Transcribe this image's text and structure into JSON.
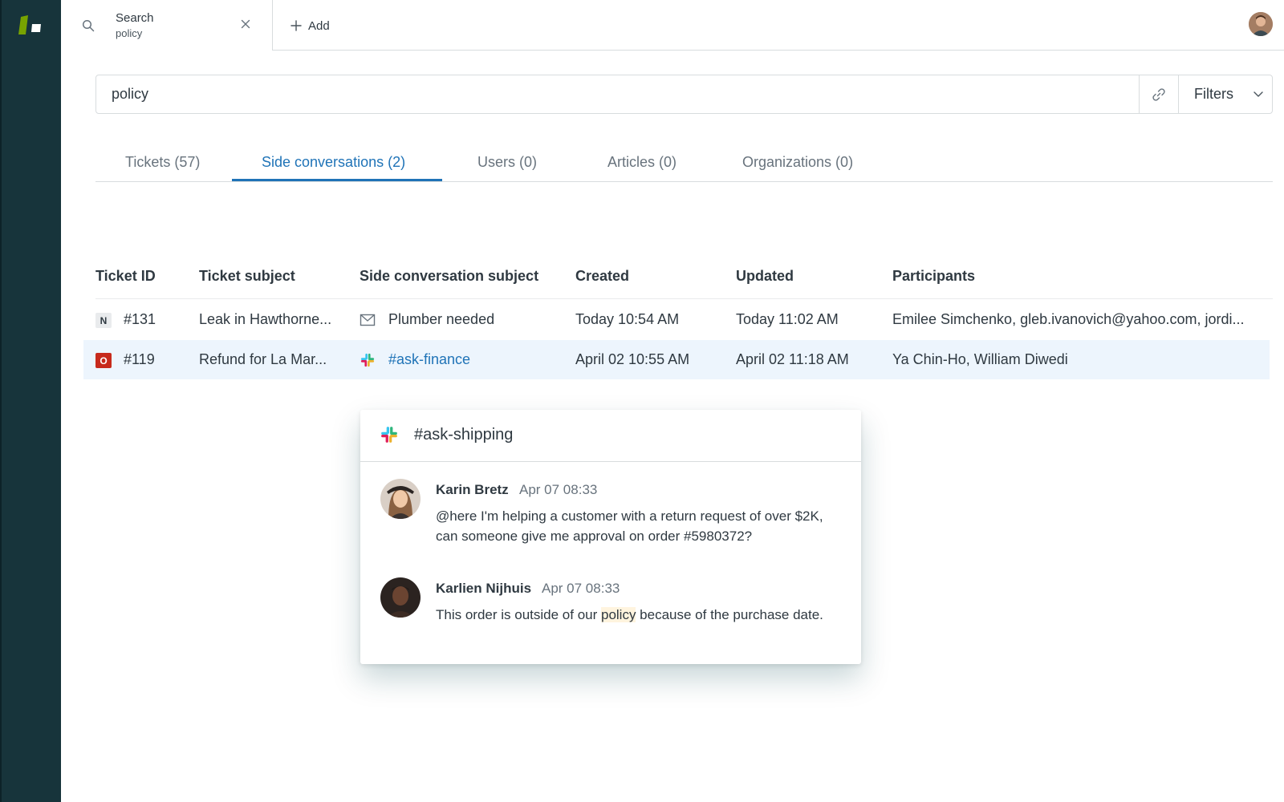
{
  "topbar": {
    "search_tab_title": "Search",
    "search_tab_subtitle": "policy",
    "add_label": "Add"
  },
  "search": {
    "query": "policy",
    "filters_label": "Filters"
  },
  "tabs": [
    {
      "label": "Tickets (57)",
      "active": false
    },
    {
      "label": "Side conversations (2)",
      "active": true
    },
    {
      "label": "Users (0)",
      "active": false
    },
    {
      "label": "Articles (0)",
      "active": false
    },
    {
      "label": "Organizations (0)",
      "active": false
    }
  ],
  "table": {
    "columns": [
      "Ticket ID",
      "Ticket subject",
      "Side conversation subject",
      "Created",
      "Updated",
      "Participants"
    ],
    "rows": [
      {
        "status": "N",
        "status_color": "#e9ebed",
        "ticket_id": "#131",
        "ticket_subject": "Leak in Hawthorne...",
        "channel_icon": "email-icon",
        "side_subject": "Plumber needed",
        "created": "Today 10:54 AM",
        "updated": "Today 11:02 AM",
        "participants": "Emilee Simchenko, gleb.ivanovich@yahoo.com, jordi..."
      },
      {
        "status": "O",
        "status_color": "#c72a1c",
        "ticket_id": "#119",
        "ticket_subject": "Refund for La Mar...",
        "channel_icon": "slack-icon",
        "side_subject": "#ask-finance",
        "created": "April 02 10:55 AM",
        "updated": "April 02 11:18 AM",
        "participants": "Ya Chin-Ho, William Diwedi"
      }
    ]
  },
  "popup": {
    "channel": "#ask-shipping",
    "messages": [
      {
        "author": "Karin Bretz",
        "time": "Apr 07 08:33",
        "text": "@here I'm helping a customer with a return request of over $2K, can someone give me approval on order #5980372?"
      },
      {
        "author": "Karlien Nijhuis",
        "time": "Apr 07 08:33",
        "text_before": "This order is outside of our ",
        "text_highlight": "policy",
        "text_after": " because of the purchase date."
      }
    ]
  },
  "colors": {
    "rail": "#17343b",
    "accent": "#1f73b7",
    "selected_row": "#edf5fd",
    "highlight": "#fff4de"
  }
}
